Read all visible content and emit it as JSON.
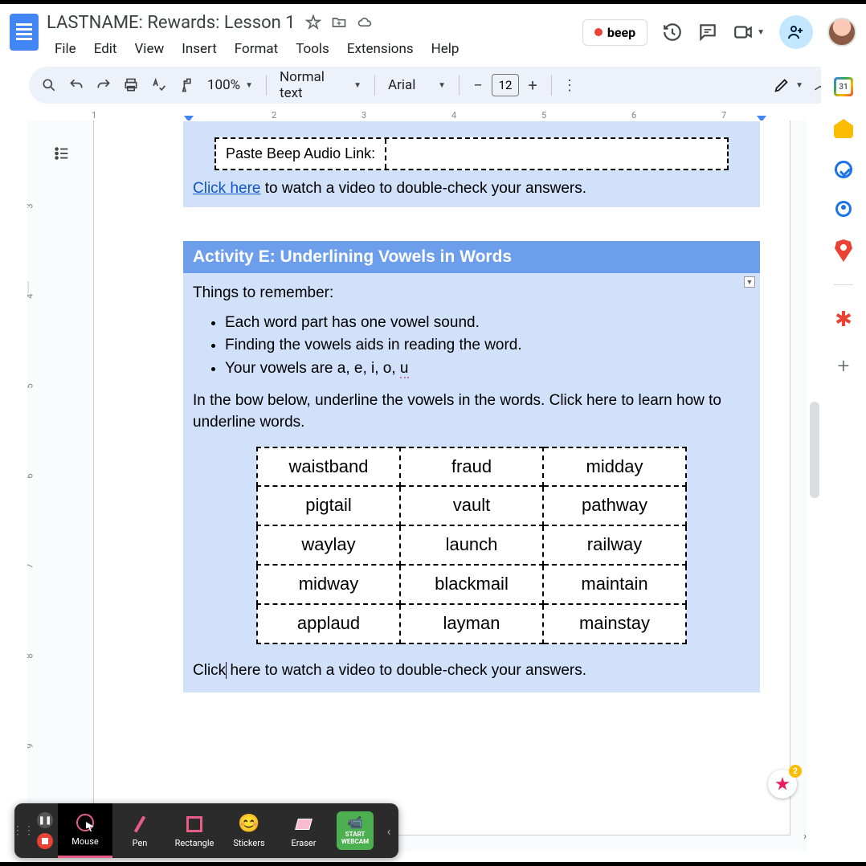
{
  "header": {
    "doc_title": "LASTNAME: Rewards: Lesson 1",
    "menus": [
      "File",
      "Edit",
      "View",
      "Insert",
      "Format",
      "Tools",
      "Extensions",
      "Help"
    ],
    "beep_label": "beep"
  },
  "toolbar": {
    "zoom": "100%",
    "style": "Normal text",
    "font": "Arial",
    "font_size": "12"
  },
  "ruler": {
    "ticks": [
      "1",
      "2",
      "3",
      "4",
      "5",
      "6",
      "7"
    ]
  },
  "vruler": {
    "ticks": [
      "3",
      "4",
      "5",
      "6",
      "7",
      "8",
      "9"
    ]
  },
  "prev_activity": {
    "audio_label": "Paste Beep Audio Link:",
    "click_link": "Click here",
    "click_rest": " to watch a video to double-check your answers."
  },
  "activity_e": {
    "title": "Activity E: Underlining Vowels in Words",
    "remember_heading": "Things to remember:",
    "bullets": [
      "Each word part has one vowel sound.",
      "Finding the vowels aids in reading the word.",
      "Your vowels are a, e, i, o, "
    ],
    "vowel_u": "u",
    "instructions": "In the bow below, underline the vowels in the words. Click here to learn how to underline words.",
    "table": [
      [
        "waistband",
        "fraud",
        "midday"
      ],
      [
        "pigtail",
        "vault",
        "pathway"
      ],
      [
        "waylay",
        "launch",
        "railway"
      ],
      [
        "midway",
        "blackmail",
        "maintain"
      ],
      [
        "applaud",
        "layman",
        "mainstay"
      ]
    ],
    "footer_click_pre": "Click",
    "footer_click_post": "here to watch a video to double-check your answers."
  },
  "explore": {
    "badge": "2"
  },
  "cast_bar": {
    "tools": [
      "Mouse",
      "Pen",
      "Rectangle",
      "Stickers",
      "Eraser"
    ],
    "webcam_l1": "START",
    "webcam_l2": "WEBCAM"
  },
  "side_calendar_day": "31"
}
